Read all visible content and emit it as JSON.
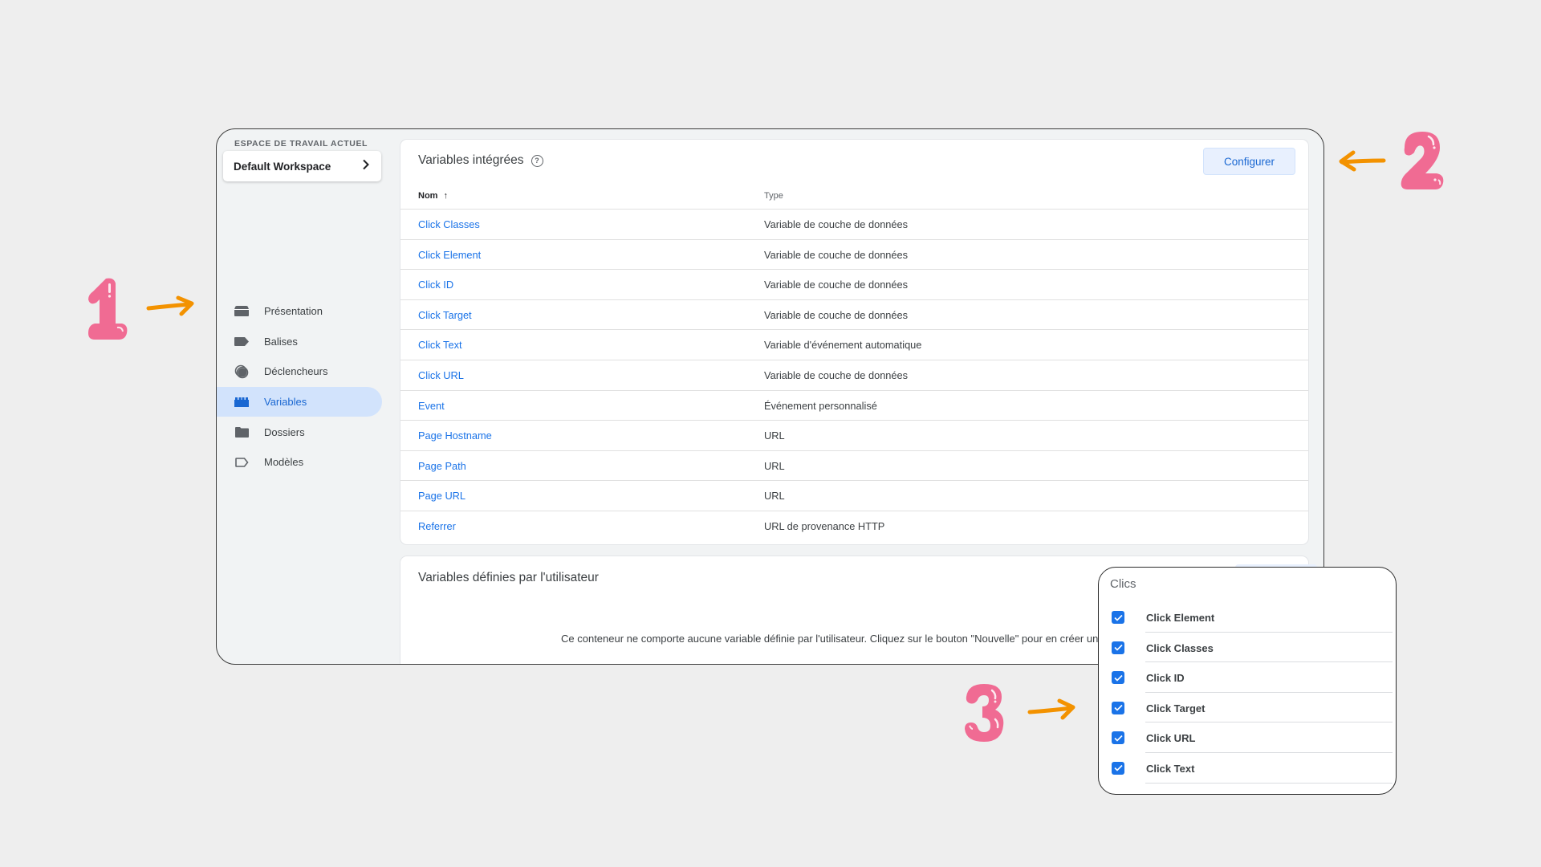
{
  "sidebar": {
    "workspace_label": "ESPACE DE TRAVAIL ACTUEL",
    "workspace_name": "Default Workspace",
    "items": [
      {
        "label": "Présentation",
        "icon": "overview-icon",
        "active": false
      },
      {
        "label": "Balises",
        "icon": "tag-icon",
        "active": false
      },
      {
        "label": "Déclencheurs",
        "icon": "trigger-icon",
        "active": false
      },
      {
        "label": "Variables",
        "icon": "variables-icon",
        "active": true
      },
      {
        "label": "Dossiers",
        "icon": "folder-icon",
        "active": false
      },
      {
        "label": "Modèles",
        "icon": "template-icon",
        "active": false
      }
    ]
  },
  "builtin": {
    "title": "Variables intégrées",
    "configure_label": "Configurer",
    "columns": {
      "name": "Nom",
      "type": "Type"
    },
    "rows": [
      {
        "name": "Click Classes",
        "type": "Variable de couche de données"
      },
      {
        "name": "Click Element",
        "type": "Variable de couche de données"
      },
      {
        "name": "Click ID",
        "type": "Variable de couche de données"
      },
      {
        "name": "Click Target",
        "type": "Variable de couche de données"
      },
      {
        "name": "Click Text",
        "type": "Variable d'événement automatique"
      },
      {
        "name": "Click URL",
        "type": "Variable de couche de données"
      },
      {
        "name": "Event",
        "type": "Événement personnalisé"
      },
      {
        "name": "Page Hostname",
        "type": "URL"
      },
      {
        "name": "Page Path",
        "type": "URL"
      },
      {
        "name": "Page URL",
        "type": "URL"
      },
      {
        "name": "Referrer",
        "type": "URL de provenance HTTP"
      }
    ]
  },
  "user_defined": {
    "title": "Variables définies par l'utilisateur",
    "empty_message": "Ce conteneur ne comporte aucune variable définie par l'utilisateur. Cliquez sur le bouton \"Nouvelle\" pour en créer une."
  },
  "popup": {
    "title": "Clics",
    "items": [
      {
        "label": "Click Element",
        "checked": true
      },
      {
        "label": "Click Classes",
        "checked": true
      },
      {
        "label": "Click ID",
        "checked": true
      },
      {
        "label": "Click Target",
        "checked": true
      },
      {
        "label": "Click URL",
        "checked": true
      },
      {
        "label": "Click Text",
        "checked": true
      }
    ]
  },
  "annotations": [
    {
      "number": "1",
      "target": "Variables sidebar item"
    },
    {
      "number": "2",
      "target": "Configurer button"
    },
    {
      "number": "3",
      "target": "Clics checklist"
    }
  ],
  "colors": {
    "accent_blue": "#1a73e8",
    "active_nav_bg": "#d2e3fc",
    "annotation_pink": "#f06b93",
    "annotation_orange": "#f39200"
  }
}
